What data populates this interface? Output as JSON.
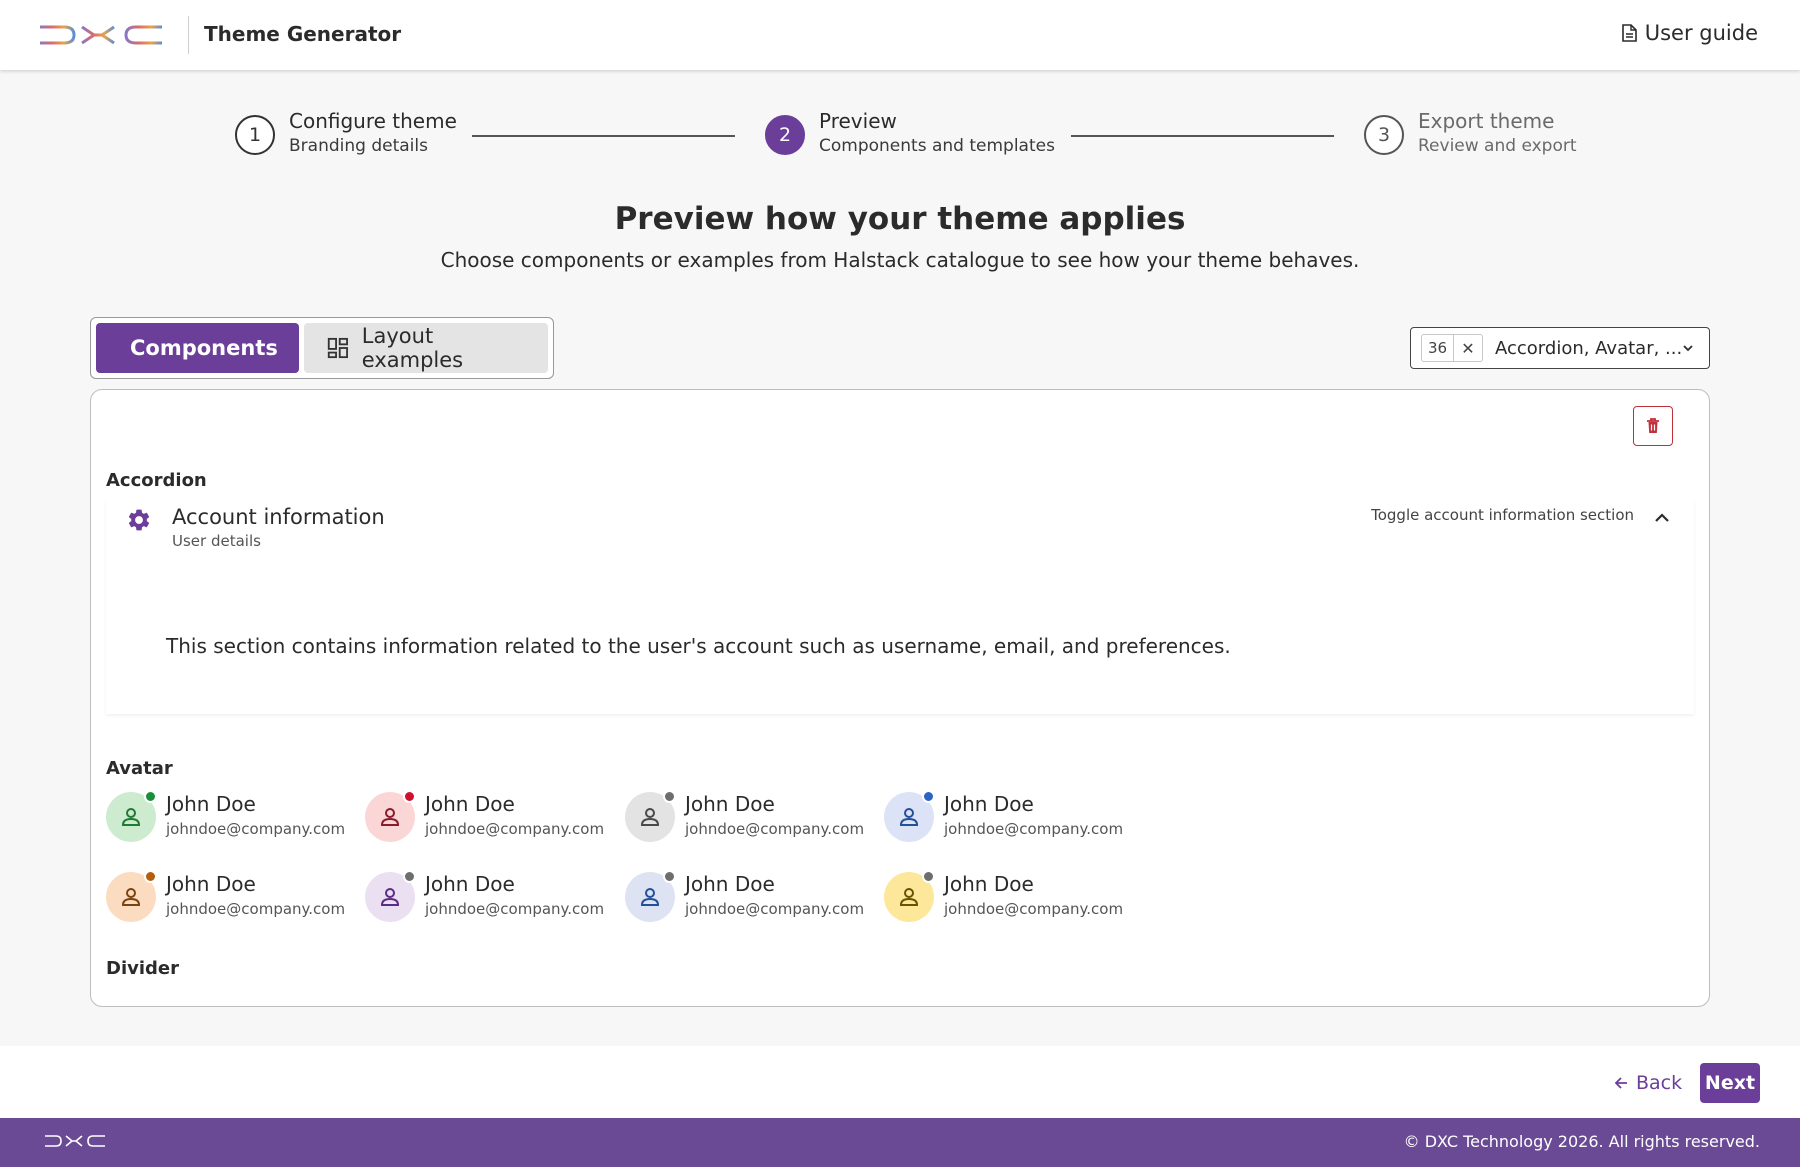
{
  "header": {
    "app_title": "Theme Generator",
    "user_guide_label": "User guide",
    "logo_icon": "dxc-logo",
    "doc_icon": "document-icon"
  },
  "stepper": {
    "steps": [
      {
        "number": "1",
        "title": "Configure theme",
        "subtitle": "Branding details",
        "state": "completed"
      },
      {
        "number": "2",
        "title": "Preview",
        "subtitle": "Components and templates",
        "state": "active"
      },
      {
        "number": "3",
        "title": "Export theme",
        "subtitle": "Review and export",
        "state": "upcoming"
      }
    ]
  },
  "main": {
    "heading": "Preview how your theme applies",
    "subheading": "Choose components or examples from Halstack catalogue to see how your theme behaves."
  },
  "view_toggle": {
    "components_label": "Components",
    "layout_label": "Layout examples",
    "selected": "Components"
  },
  "component_select": {
    "count": "36",
    "clear_symbol": "✕",
    "value": "Accordion, Avatar, ..."
  },
  "preview": {
    "accordion_section_title": "Accordion",
    "accordion": {
      "title": "Account information",
      "subtitle": "User details",
      "toggle_label": "Toggle account information section",
      "content": "This section contains information related to the user's account such as username, email, and preferences.",
      "expanded": true
    },
    "avatar_section_title": "Avatar",
    "avatars": [
      {
        "name": "John Doe",
        "email": "johndoe@company.com",
        "bg": "#cdeccf",
        "fg": "#1f7a33",
        "status": "#1a8f3a"
      },
      {
        "name": "John Doe",
        "email": "johndoe@company.com",
        "bg": "#fbd6d6",
        "fg": "#8a1c2a",
        "status": "#d0102f"
      },
      {
        "name": "John Doe",
        "email": "johndoe@company.com",
        "bg": "#e3e3e3",
        "fg": "#4a4a4a",
        "status": "#6e6e6e"
      },
      {
        "name": "John Doe",
        "email": "johndoe@company.com",
        "bg": "#dde3f6",
        "fg": "#24509a",
        "status": "#2d63c4"
      },
      {
        "name": "John Doe",
        "email": "johndoe@company.com",
        "bg": "#fcdcc0",
        "fg": "#7a4410",
        "status": "#b55f0c"
      },
      {
        "name": "John Doe",
        "email": "johndoe@company.com",
        "bg": "#ebdff2",
        "fg": "#5c2d86",
        "status": "#6e6e6e"
      },
      {
        "name": "John Doe",
        "email": "johndoe@company.com",
        "bg": "#dde3f3",
        "fg": "#24509a",
        "status": "#6e6e6e"
      },
      {
        "name": "John Doe",
        "email": "johndoe@company.com",
        "bg": "#fde79a",
        "fg": "#6b5200",
        "status": "#6e6e6e"
      }
    ],
    "divider_section_title": "Divider"
  },
  "navigation": {
    "back_label": "Back",
    "next_label": "Next"
  },
  "footer": {
    "copyright": "© DXC Technology 2026. All rights reserved."
  },
  "colors": {
    "accent": "#6b3e9a",
    "footer_bg": "#6b4a95",
    "danger": "#c0303a"
  }
}
